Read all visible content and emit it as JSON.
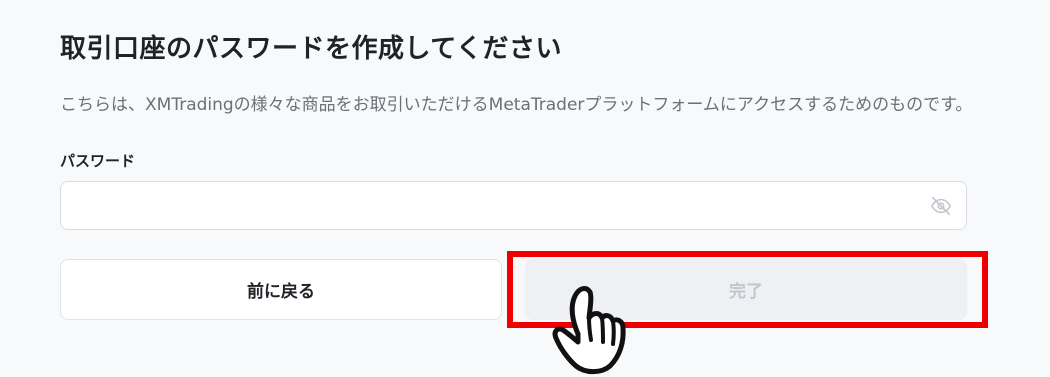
{
  "page": {
    "title": "取引口座のパスワードを作成してください",
    "description": "こちらは、XMTradingの様々な商品をお取引いただけるMetaTraderプラットフォームにアクセスするためのものです。"
  },
  "password": {
    "label": "パスワード",
    "value": "",
    "placeholder": "",
    "toggle_icon": "eye-off-icon"
  },
  "buttons": {
    "back_label": "前に戻る",
    "done_label": "完了"
  },
  "colors": {
    "highlight": "#ee0000",
    "background": "#f7f9fb",
    "disabled_button": "#eef0f3"
  }
}
